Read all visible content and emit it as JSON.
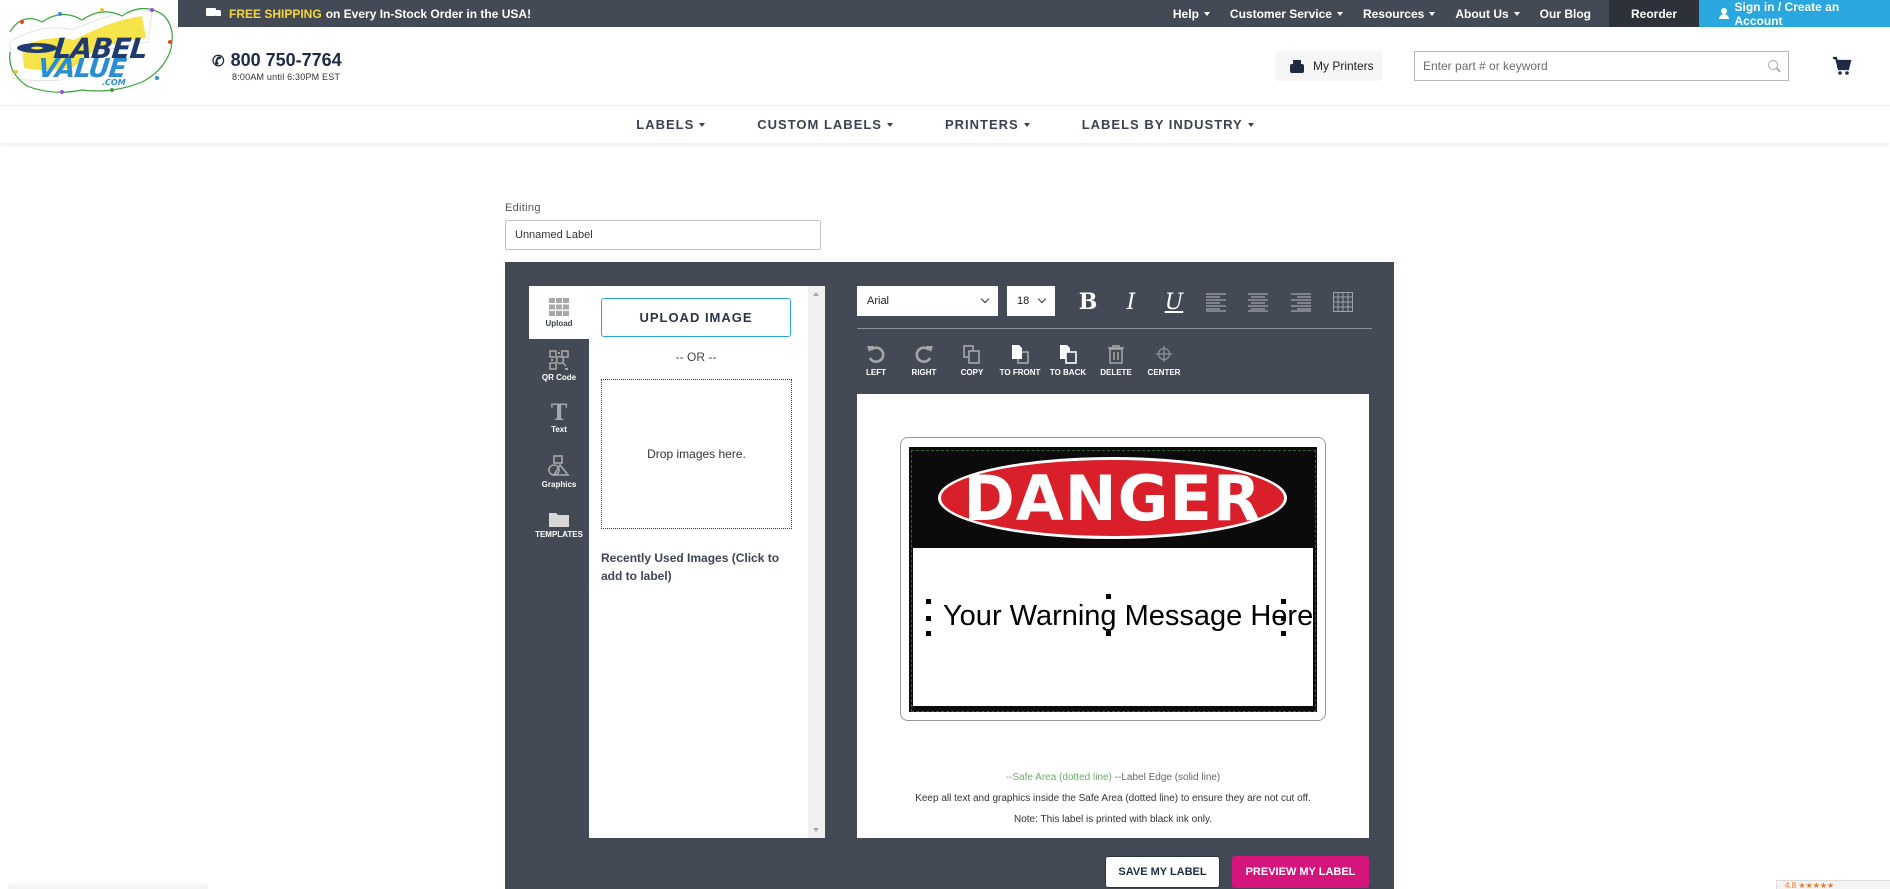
{
  "topbar": {
    "shipping_highlight": "FREE SHIPPING",
    "shipping_text": "on Every In-Stock Order in the USA!",
    "nav": [
      {
        "label": "Help",
        "dropdown": true
      },
      {
        "label": "Customer Service",
        "dropdown": true
      },
      {
        "label": "Resources",
        "dropdown": true
      },
      {
        "label": "About Us",
        "dropdown": true
      },
      {
        "label": "Our Blog",
        "dropdown": false
      }
    ],
    "reorder_label": "Reorder",
    "signin_label": "Sign in / Create an Account"
  },
  "brand": {
    "logo_line1": "LABEL",
    "logo_line2": "VALUE",
    "logo_suffix": ".COM",
    "colors": {
      "navy": "#1e3a6e",
      "blue": "#2a8fd0",
      "yellow": "#f7e34a"
    }
  },
  "header": {
    "phone": "800 750-7764",
    "hours": "8:00AM until 6:30PM EST",
    "my_printers_label": "My Printers",
    "search_placeholder": "Enter part # or keyword"
  },
  "mainnav": [
    {
      "label": "LABELS"
    },
    {
      "label": "CUSTOM LABELS"
    },
    {
      "label": "PRINTERS"
    },
    {
      "label": "LABELS BY INDUSTRY"
    }
  ],
  "editing": {
    "label": "Editing",
    "value": "Unnamed Label"
  },
  "rail": [
    {
      "label": "Upload",
      "icon": "grid-icon",
      "active": true
    },
    {
      "label": "QR Code",
      "icon": "qr-code-icon",
      "active": false
    },
    {
      "label": "Text",
      "icon": "text-icon",
      "active": false
    },
    {
      "label": "Graphics",
      "icon": "shapes-icon",
      "active": false
    },
    {
      "label": "TEMPLATES",
      "icon": "folder-icon",
      "active": false
    }
  ],
  "upload_panel": {
    "upload_button": "UPLOAD IMAGE",
    "or_text": "-- OR --",
    "drop_text": "Drop images here.",
    "recent_text": "Recently Used Images (Click to add to label)"
  },
  "format_toolbar": {
    "font": "Arial",
    "size": "18",
    "bold": "B",
    "italic": "I",
    "underline": "U"
  },
  "action_toolbar": [
    {
      "label": "LEFT",
      "icon": "rotate-left-icon"
    },
    {
      "label": "RIGHT",
      "icon": "rotate-right-icon"
    },
    {
      "label": "COPY",
      "icon": "copy-icon"
    },
    {
      "label": "TO FRONT",
      "icon": "bring-to-front-icon"
    },
    {
      "label": "TO BACK",
      "icon": "send-to-back-icon"
    },
    {
      "label": "DELETE",
      "icon": "trash-icon"
    },
    {
      "label": "CENTER",
      "icon": "crosshair-icon"
    }
  ],
  "canvas": {
    "header_text": "DANGER",
    "message_text": "Your Warning Message Here",
    "safe_area_note": "--Safe Area (dotted line)",
    "label_edge_note": "--Label Edge (solid line)",
    "keep_note": "Keep all text and graphics inside the Safe Area (dotted line) to ensure they are not cut off.",
    "ink_note": "Note: This label is printed with black ink only.",
    "colors": {
      "danger_red": "#d9202a",
      "safe_line": "#6dae6a"
    }
  },
  "buttons": {
    "save": "SAVE MY LABEL",
    "preview": "PREVIEW MY LABEL",
    "preview_color": "#d4157c"
  },
  "rating_badge": {
    "score": "4.8",
    "stars": "★★★★★"
  }
}
